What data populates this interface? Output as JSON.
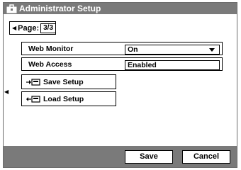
{
  "window": {
    "title": "Administrator Setup"
  },
  "pager": {
    "label": "Page:",
    "value": "3/3"
  },
  "settings": [
    {
      "label": "Web Monitor",
      "value": "On"
    },
    {
      "label": "Web Access",
      "value": "Enabled"
    }
  ],
  "actions": {
    "save_setup": "Save Setup",
    "load_setup": "Load Setup"
  },
  "footer": {
    "save": "Save",
    "cancel": "Cancel"
  },
  "colors": {
    "bar": "#7a7a7a",
    "panel": "#ffffff",
    "border": "#000000"
  }
}
